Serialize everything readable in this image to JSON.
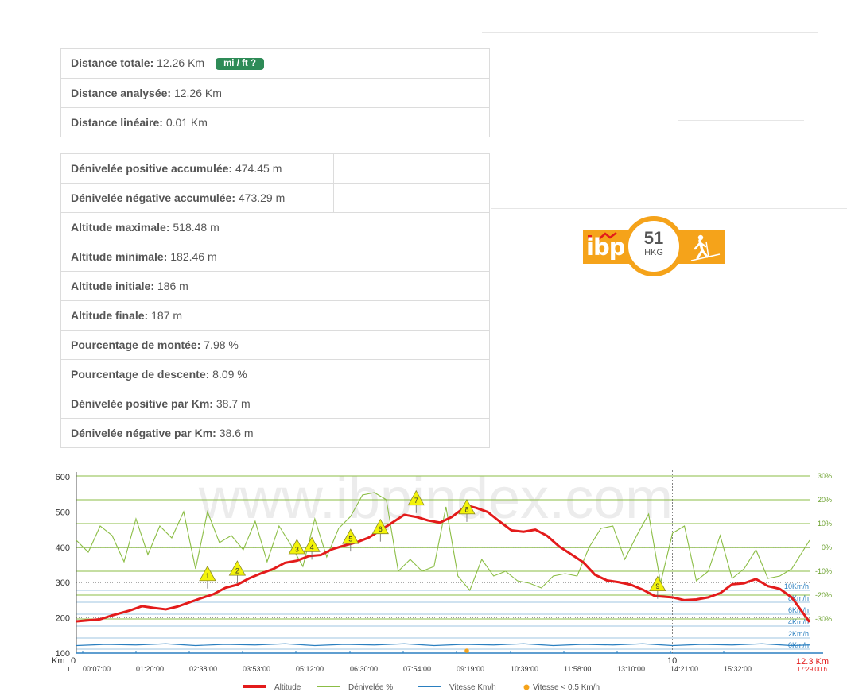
{
  "distance_table": [
    {
      "label": "Distance totale:",
      "value": "12.26 Km",
      "button": "mi / ft ?"
    },
    {
      "label": "Distance analysée:",
      "value": "12.26 Km"
    },
    {
      "label": "Distance linéaire:",
      "value": "0.01 Km"
    }
  ],
  "elevation_table": [
    {
      "label": "Dénivelée positive accumulée:",
      "value": "474.45 m"
    },
    {
      "label": "Dénivelée négative accumulée:",
      "value": "473.29 m"
    },
    {
      "label": "Altitude maximale:",
      "value": "518.48 m"
    },
    {
      "label": "Altitude minimale:",
      "value": "182.46 m"
    },
    {
      "label": "Altitude initiale:",
      "value": "186 m"
    },
    {
      "label": "Altitude finale:",
      "value": "187 m"
    },
    {
      "label": "Pourcentage de montée:",
      "value": "7.98 %"
    },
    {
      "label": "Pourcentage de descente:",
      "value": "8.09 %"
    },
    {
      "label": "Dénivelée positive par Km:",
      "value": "38.7 m"
    },
    {
      "label": "Dénivelée négative par Km:",
      "value": "38.6 m"
    }
  ],
  "ibp": {
    "logo": "ibp",
    "score": "51",
    "unit": "HKG",
    "activity_icon": "hiker-icon"
  },
  "colors": {
    "altitude": "#e31b1b",
    "gradient": "#8bbd45",
    "speed": "#2a7fc0",
    "slow": "#f5a31a",
    "badge": "#2e8b57",
    "ibp": "#f5a31a"
  },
  "chart_data": {
    "type": "line",
    "watermark": "www.ibpindex.com",
    "x_axis": {
      "label": "Km",
      "range": [
        0,
        12.3
      ],
      "tick_labels": [
        "0",
        "10"
      ],
      "end_label": "12.3 Km",
      "time_prefix": "T",
      "time_ticks": [
        "00:07:00",
        "01:20:00",
        "02:38:00",
        "03:53:00",
        "05:12:00",
        "06:30:00",
        "07:54:00",
        "09:19:00",
        "10:39:00",
        "11:58:00",
        "13:10:00",
        "14:21:00",
        "15:32:00"
      ],
      "end_time": "17:29:00 h"
    },
    "y_left": {
      "range": [
        100,
        600
      ],
      "ticks": [
        600,
        500,
        400,
        300,
        200,
        100
      ]
    },
    "y_right_gradient": {
      "range": [
        -30,
        30
      ],
      "tick_labels": [
        "30%",
        "20%",
        "10%",
        "0%",
        "-10%",
        "-20%",
        "-30%"
      ]
    },
    "y_right_speed": {
      "tick_labels": [
        "10Km/h",
        "8Km/h",
        "6Km/h",
        "4Km/h",
        "2Km/h",
        "0Km/h"
      ]
    },
    "legend": [
      "Altitude",
      "Dénivelée %",
      "Vitesse Km/h",
      "Vitesse < 0.5 Km/h"
    ],
    "series": [
      {
        "name": "Altitude",
        "unit": "m",
        "x": [
          0,
          0.4,
          0.6,
          0.9,
          1.1,
          1.3,
          1.5,
          1.7,
          1.9,
          2.1,
          2.3,
          2.5,
          2.7,
          2.9,
          3.1,
          3.3,
          3.5,
          3.7,
          3.9,
          4.1,
          4.3,
          4.5,
          4.7,
          4.9,
          5.1,
          5.3,
          5.5,
          5.7,
          5.9,
          6.1,
          6.3,
          6.55,
          6.7,
          6.9,
          7.1,
          7.3,
          7.5,
          7.7,
          7.9,
          8.1,
          8.3,
          8.5,
          8.7,
          8.9,
          9.1,
          9.3,
          9.5,
          9.7,
          10.0,
          10.2,
          10.4,
          10.6,
          10.8,
          11.0,
          11.2,
          11.4,
          11.6,
          11.8,
          12.0,
          12.3
        ],
        "y": [
          190,
          196,
          207,
          221,
          233,
          228,
          224,
          232,
          244,
          256,
          267,
          285,
          294,
          312,
          326,
          338,
          356,
          362,
          375,
          378,
          395,
          405,
          414,
          427,
          448,
          470,
          492,
          486,
          476,
          470,
          486,
          518,
          512,
          500,
          473,
          448,
          444,
          450,
          432,
          402,
          380,
          358,
          322,
          306,
          301,
          294,
          280,
          262,
          258,
          250,
          252,
          258,
          270,
          295,
          298,
          310,
          290,
          282,
          258,
          188
        ]
      },
      {
        "name": "Dénivelée %",
        "unit": "%",
        "x": [
          0,
          0.2,
          0.4,
          0.6,
          0.8,
          1.0,
          1.2,
          1.4,
          1.6,
          1.8,
          2.0,
          2.2,
          2.4,
          2.6,
          2.8,
          3.0,
          3.2,
          3.4,
          3.6,
          3.8,
          4.0,
          4.2,
          4.4,
          4.6,
          4.8,
          5.0,
          5.2,
          5.4,
          5.6,
          5.8,
          6.0,
          6.2,
          6.4,
          6.6,
          6.8,
          7.0,
          7.2,
          7.4,
          7.6,
          7.8,
          8.0,
          8.2,
          8.4,
          8.6,
          8.8,
          9.0,
          9.2,
          9.4,
          9.6,
          9.8,
          10.0,
          10.2,
          10.4,
          10.6,
          10.8,
          11.0,
          11.2,
          11.4,
          11.6,
          11.8,
          12.0,
          12.3
        ],
        "y": [
          3,
          -2,
          9,
          5,
          -6,
          12,
          -3,
          9,
          4,
          15,
          -9,
          15,
          2,
          5,
          -1,
          11,
          -6,
          9,
          1,
          -8,
          12,
          -4,
          8,
          13,
          22,
          23,
          20,
          -10,
          -5,
          -10,
          -8,
          17,
          -12,
          -18,
          -5,
          -12,
          -10,
          -14,
          -15,
          -17,
          -12,
          -11,
          -12,
          0,
          8,
          9,
          -5,
          5,
          14,
          -15,
          6,
          9,
          -14,
          -10,
          5,
          -13,
          -9,
          -1,
          -13,
          -12,
          -9,
          3
        ]
      },
      {
        "name": "Vitesse Km/h",
        "unit": "Km/h",
        "x": [
          0,
          0.5,
          1,
          1.5,
          2,
          2.5,
          3,
          3.5,
          4,
          4.5,
          5,
          5.5,
          6,
          6.5,
          7,
          7.5,
          8,
          8.5,
          9,
          9.5,
          10,
          10.5,
          11,
          11.5,
          12,
          12.3
        ],
        "y": [
          0.6,
          0.8,
          0.7,
          0.9,
          0.6,
          0.8,
          0.7,
          0.9,
          0.6,
          0.8,
          0.7,
          0.9,
          0.6,
          0.8,
          0.7,
          0.9,
          0.6,
          0.8,
          0.7,
          0.9,
          0.6,
          0.8,
          0.7,
          0.9,
          0.6,
          0.7
        ]
      },
      {
        "name": "Vitesse < 0.5 Km/h",
        "x": [
          6.55
        ],
        "y": [
          0.2
        ]
      }
    ],
    "waypoints": [
      {
        "label": "1",
        "km": 2.2,
        "alt": 283
      },
      {
        "label": "2",
        "km": 2.7,
        "alt": 298
      },
      {
        "label": "3",
        "km": 3.7,
        "alt": 359
      },
      {
        "label": "4",
        "km": 3.95,
        "alt": 365
      },
      {
        "label": "5",
        "km": 4.6,
        "alt": 388
      },
      {
        "label": "6",
        "km": 5.1,
        "alt": 416
      },
      {
        "label": "7",
        "km": 5.7,
        "alt": 497
      },
      {
        "label": "8",
        "km": 6.55,
        "alt": 472
      },
      {
        "label": "9",
        "km": 9.75,
        "alt": 254
      }
    ],
    "cursor_km": 10
  }
}
